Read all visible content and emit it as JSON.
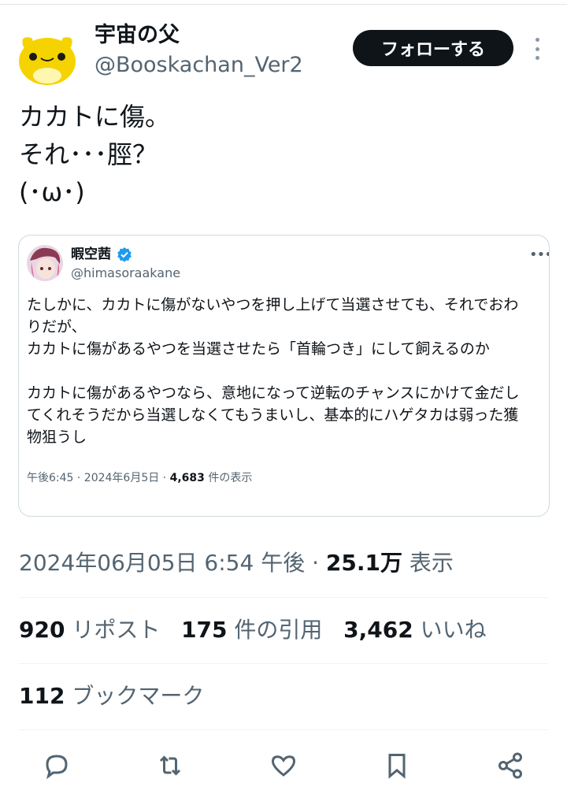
{
  "author": {
    "display_name": "宇宙の父",
    "handle": "@Booskachan_Ver2",
    "follow_label": "フォローする"
  },
  "tweet": {
    "lines": [
      "カカトに傷。",
      "それ･･･脛？",
      "(･ω･)"
    ]
  },
  "quote": {
    "display_name": "暇空茜",
    "handle": "@himasoraakane",
    "body_p1_line1": "たしかに、カカトに傷がないやつを押し上げて当選させても、それでおわ",
    "body_p1_line2": "りだが、",
    "body_p1_line3": "カカトに傷があるやつを当選させたら「首輪つき」にして飼えるのか",
    "body_p2_line1": "カカトに傷があるやつなら、意地になって逆転のチャンスにかけて金だし",
    "body_p2_line2": "てくれそうだから当選しなくてもうまいし、基本的にハゲタカは弱った獲",
    "body_p2_line3": "物狙うし",
    "meta_time": "午後6:45 · 2024年6月5日 · ",
    "meta_views": "4,683",
    "meta_views_label": " 件の表示",
    "more_label": "•••"
  },
  "timestamp": {
    "text": "2024年06月05日 6:54 午後 · ",
    "views": "25.1万",
    "views_label": " 表示"
  },
  "stats": {
    "reposts": "920",
    "reposts_label": " リポスト",
    "quotes": "175",
    "quotes_label": " 件の引用",
    "likes": "3,462",
    "likes_label": " いいね",
    "bookmarks": "112",
    "bookmarks_label": " ブックマーク"
  },
  "icons": {
    "reply": "reply-icon",
    "retweet": "retweet-icon",
    "like": "heart-icon",
    "bookmark": "bookmark-icon",
    "share": "share-icon",
    "verified": "verified-badge-icon",
    "more": "more-dots-icon"
  },
  "colors": {
    "text": "#0f1419",
    "secondary": "#536471",
    "verified": "#1d9bf0",
    "border": "#cfd9de"
  }
}
